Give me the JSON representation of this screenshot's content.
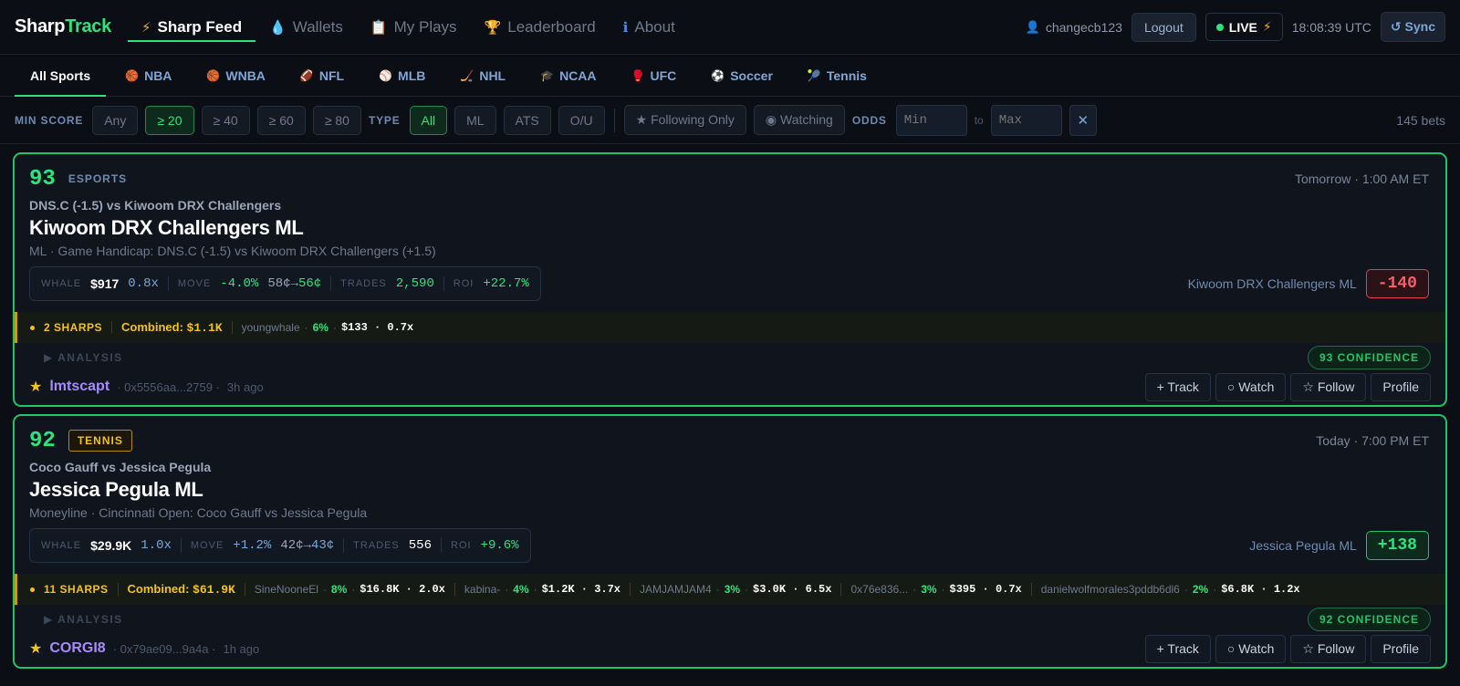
{
  "brand": {
    "part1": "Sharp",
    "part2": "Track"
  },
  "nav": [
    {
      "icon": "⚡",
      "label": "Sharp Feed"
    },
    {
      "icon": "💧",
      "label": "Wallets"
    },
    {
      "icon": "📋",
      "label": "My Plays"
    },
    {
      "icon": "🏆",
      "label": "Leaderboard"
    },
    {
      "icon": "ℹ",
      "label": "About"
    }
  ],
  "header": {
    "username": "changecb123",
    "logout": "Logout",
    "live": "LIVE",
    "time": "18:08:39 UTC",
    "sync": "↺ Sync"
  },
  "sports": [
    {
      "icon": "",
      "label": "All Sports"
    },
    {
      "icon": "🏀",
      "label": "NBA"
    },
    {
      "icon": "🏀",
      "label": "WNBA"
    },
    {
      "icon": "🏈",
      "label": "NFL"
    },
    {
      "icon": "⚾",
      "label": "MLB"
    },
    {
      "icon": "🏒",
      "label": "NHL"
    },
    {
      "icon": "🎓",
      "label": "NCAA"
    },
    {
      "icon": "🥊",
      "label": "UFC"
    },
    {
      "icon": "⚽",
      "label": "Soccer"
    },
    {
      "icon": "🎾",
      "label": "Tennis"
    }
  ],
  "filters": {
    "min_score_label": "MIN SCORE",
    "min_score": [
      "Any",
      "≥ 20",
      "≥ 40",
      "≥ 60",
      "≥ 80"
    ],
    "type_label": "TYPE",
    "types": [
      "All",
      "ML",
      "ATS",
      "O/U"
    ],
    "following": "★ Following Only",
    "watching": "◉ Watching",
    "odds_label": "ODDS",
    "odds_min_placeholder": "Min",
    "odds_to": "to",
    "odds_max_placeholder": "Max",
    "clear": "✕",
    "count": "145 bets"
  },
  "cards": [
    {
      "score": "93",
      "sport": "ESPORTS",
      "when": "Tomorrow · 1:00 AM ET",
      "matchup": "DNS.C (-1.5) vs Kiwoom DRX Challengers",
      "pick": "Kiwoom DRX Challengers ML",
      "desc": "ML · Game Handicap: DNS.C (-1.5) vs Kiwoom DRX Challengers (+1.5)",
      "stats": {
        "whale_label": "WHALE",
        "whale": "$917",
        "mult": "0.8x",
        "move_label": "MOVE",
        "move": "-4.0%",
        "from": "58¢",
        "arrow": "→",
        "to": "56¢",
        "trades_label": "TRADES",
        "trades": "2,590",
        "roi_label": "ROI",
        "roi": "+22.7%"
      },
      "odds_side": "Kiwoom DRX Challengers ML",
      "odds": "-140",
      "sharps": {
        "count": "2 SHARPS",
        "combined_label": "Combined:",
        "combined": "$1.1K",
        "whales": [
          {
            "name": "youngwhale",
            "pct": "6%",
            "amt": "$133 · 0.7x"
          }
        ]
      },
      "analysis": "▶ ANALYSIS",
      "confidence": "93 CONFIDENCE",
      "trader": "lmtscapt",
      "addr": "0x5556aa...2759",
      "ago": "3h ago"
    },
    {
      "score": "92",
      "sport": "TENNIS",
      "when": "Today · 7:00 PM ET",
      "matchup": "Coco Gauff vs Jessica Pegula",
      "pick": "Jessica Pegula ML",
      "desc": "Moneyline · Cincinnati Open: Coco Gauff vs Jessica Pegula",
      "stats": {
        "whale_label": "WHALE",
        "whale": "$29.9K",
        "mult": "1.0x",
        "move_label": "MOVE",
        "move": "+1.2%",
        "from": "42¢",
        "arrow": "→",
        "to": "43¢",
        "trades_label": "TRADES",
        "trades": "556",
        "roi_label": "ROI",
        "roi": "+9.6%"
      },
      "odds_side": "Jessica Pegula ML",
      "odds": "+138",
      "sharps": {
        "count": "11 SHARPS",
        "combined_label": "Combined:",
        "combined": "$61.9K",
        "whales": [
          {
            "name": "SineNooneEl",
            "pct": "8%",
            "amt": "$16.8K · 2.0x"
          },
          {
            "name": "kabina-",
            "pct": "4%",
            "amt": "$1.2K · 3.7x"
          },
          {
            "name": "JAMJAMJAM4",
            "pct": "3%",
            "amt": "$3.0K · 6.5x"
          },
          {
            "name": "0x76e836...",
            "pct": "3%",
            "amt": "$395 · 0.7x"
          },
          {
            "name": "danielwolfmorales3pddb6dl6",
            "pct": "2%",
            "amt": "$6.8K · 1.2x"
          }
        ]
      },
      "analysis": "▶ ANALYSIS",
      "confidence": "92 CONFIDENCE",
      "trader": "CORGI8",
      "addr": "0x79ae09...9a4a",
      "ago": "1h ago"
    }
  ],
  "actions": [
    "+ Track",
    "○ Watch",
    "☆ Follow",
    "Profile"
  ]
}
